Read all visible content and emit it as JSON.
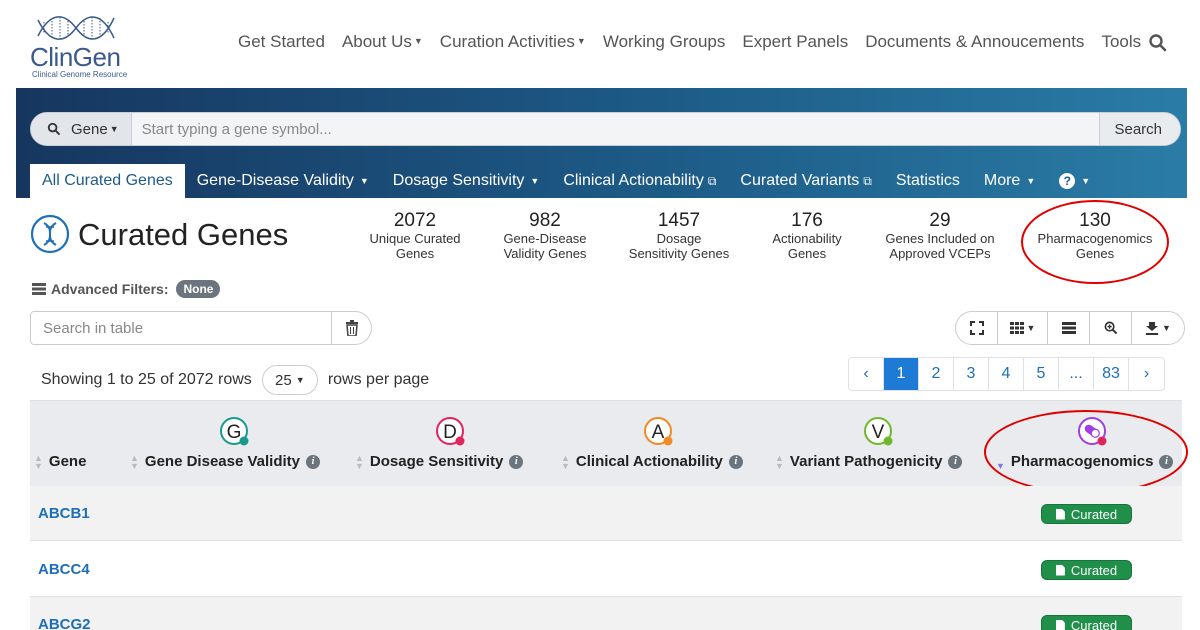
{
  "logo": {
    "name": "ClinGen",
    "subtitle": "Clinical Genome Resource"
  },
  "nav": {
    "items": [
      {
        "label": "Get Started",
        "dropdown": false
      },
      {
        "label": "About Us",
        "dropdown": true
      },
      {
        "label": "Curation Activities",
        "dropdown": true
      },
      {
        "label": "Working Groups",
        "dropdown": false
      },
      {
        "label": "Expert Panels",
        "dropdown": false
      },
      {
        "label": "Documents & Annoucements",
        "dropdown": false
      },
      {
        "label": "Tools",
        "dropdown": false
      }
    ],
    "search_icon": "search-icon"
  },
  "search": {
    "type_label": "Gene",
    "placeholder": "Start typing a gene symbol...",
    "button_label": "Search"
  },
  "tabs": [
    {
      "label": "All Curated Genes",
      "active": true
    },
    {
      "label": "Gene-Disease Validity",
      "dropdown": true
    },
    {
      "label": "Dosage Sensitivity",
      "dropdown": true
    },
    {
      "label": "Clinical Actionability",
      "external": true
    },
    {
      "label": "Curated Variants",
      "external": true
    },
    {
      "label": "Statistics"
    },
    {
      "label": "More",
      "dropdown": true
    },
    {
      "label": "?",
      "dropdown": true
    }
  ],
  "page": {
    "title": "Curated Genes"
  },
  "stats": [
    {
      "value": "2072",
      "label1": "Unique Curated",
      "label2": "Genes"
    },
    {
      "value": "982",
      "label1": "Gene-Disease",
      "label2": "Validity Genes"
    },
    {
      "value": "1457",
      "label1": "Dosage",
      "label2": "Sensitivity Genes"
    },
    {
      "value": "176",
      "label1": "Actionability",
      "label2": "Genes"
    },
    {
      "value": "29",
      "label1": "Genes Included on",
      "label2": "Approved VCEPs"
    },
    {
      "value": "130",
      "label1": "Pharmacogenomics",
      "label2": "Genes"
    }
  ],
  "filters": {
    "label": "Advanced Filters:",
    "value": "None"
  },
  "table_search": {
    "placeholder": "Search in table"
  },
  "paging": {
    "showing": "Showing 1 to 25 of 2072 rows",
    "rows_per_page_value": "25",
    "rows_per_page_label": "rows per page",
    "pages": [
      "‹",
      "1",
      "2",
      "3",
      "4",
      "5",
      "...",
      "83",
      "›"
    ],
    "active_page": "1"
  },
  "table": {
    "columns": [
      {
        "label": "Gene"
      },
      {
        "label": "Gene Disease Validity",
        "icon_letter": "G",
        "color": "#1a9a8a"
      },
      {
        "label": "Dosage Sensitivity",
        "icon_letter": "D",
        "color": "#e0245e"
      },
      {
        "label": "Clinical Actionability",
        "icon_letter": "A",
        "color": "#f08a24"
      },
      {
        "label": "Variant Pathogenicity",
        "icon_letter": "V",
        "color": "#6fb82e"
      },
      {
        "label": "Pharmacogenomics",
        "color": "#a040e0"
      }
    ],
    "rows": [
      {
        "gene": "ABCB1",
        "pharmacogenomics": "Curated"
      },
      {
        "gene": "ABCC4",
        "pharmacogenomics": "Curated"
      },
      {
        "gene": "ABCG2",
        "pharmacogenomics": "Curated"
      }
    ]
  },
  "colors": {
    "brand": "#1d5b87",
    "link": "#1d6fb8",
    "badge": "#1f8f4a",
    "highlight": "#e00000"
  }
}
